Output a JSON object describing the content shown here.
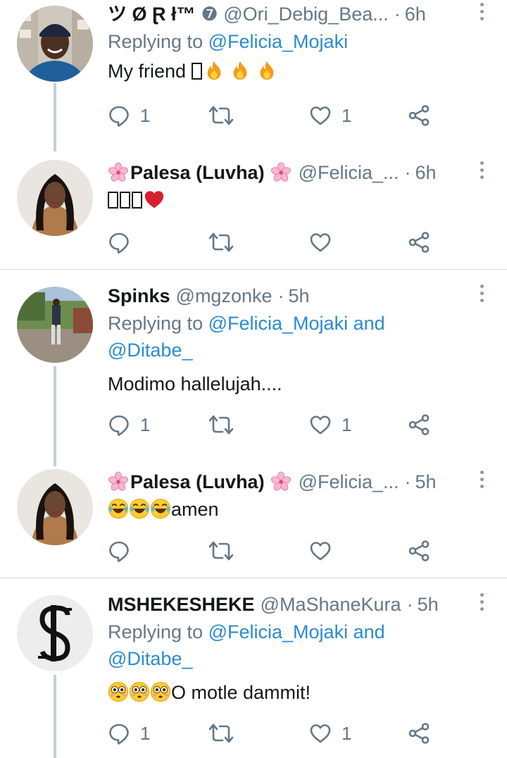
{
  "tweets": [
    {
      "name": "ツ Ø Ɽ ł™",
      "handle": "❼ @Ori_Debig_Bea...",
      "time": "6h",
      "replying": "Replying to",
      "reply_to": "@Felicia_Mojaki",
      "reply_to_2": "",
      "text": "My friend",
      "emoji": [
        "fire-emoji",
        "fire-emoji",
        "fire-emoji"
      ],
      "reply_count": "1",
      "like_count": "1",
      "avatar": "man-with-beanie-avatar"
    },
    {
      "name": "Palesa (Luvha)",
      "handle": "@Felicia_...",
      "time": "6h",
      "text": "",
      "emoji": [
        "red-heart-emoji"
      ],
      "reply_count": "",
      "like_count": "",
      "avatar": "woman-braids-avatar"
    },
    {
      "name": "Spinks",
      "handle": "@mgzonke",
      "time": "5h",
      "replying": "Replying to",
      "reply_to": "@Felicia_Mojaki and",
      "reply_to_2": "@Ditabe_",
      "text": "Modimo hallelujah....",
      "reply_count": "1",
      "like_count": "1",
      "avatar": "man-standing-outdoors-avatar"
    },
    {
      "name": "Palesa (Luvha)",
      "handle": "@Felicia_...",
      "time": "5h",
      "text": "amen",
      "emoji": [
        "tears-of-joy-emoji",
        "tears-of-joy-emoji",
        "tears-of-joy-emoji"
      ],
      "reply_count": "",
      "like_count": "",
      "avatar": "woman-braids-avatar"
    },
    {
      "name": "MSHEKESHEKE",
      "handle": "@MaShaneKura",
      "time": "5h",
      "replying": "Replying to",
      "reply_to": "@Felicia_Mojaki and",
      "reply_to_2": "@Ditabe_",
      "text": "O motle dammit!",
      "emoji": [
        "flushed-face-emoji",
        "flushed-face-emoji",
        "flushed-face-emoji"
      ],
      "reply_count": "1",
      "like_count": "1",
      "avatar": "logo-s-avatar"
    }
  ],
  "colors": {
    "link": "#2a8bd0",
    "muted": "#657786",
    "thread_line": "#c4cfd6",
    "divider": "#d9dfe3"
  },
  "icons": [
    "reply-icon",
    "retweet-icon",
    "like-icon",
    "share-icon",
    "more-icon"
  ]
}
